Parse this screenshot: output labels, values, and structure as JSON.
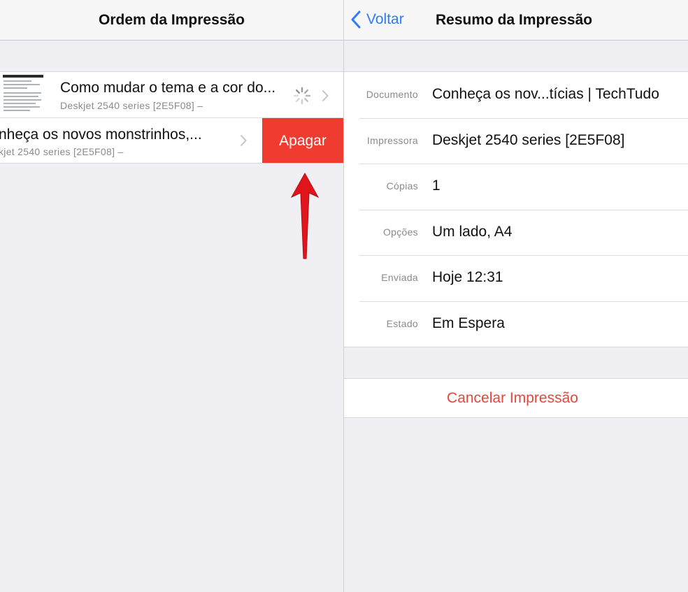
{
  "left": {
    "title": "Ordem da Impressão",
    "jobs": [
      {
        "title": "Como mudar o tema e a cor do...",
        "subtitle": "Deskjet 2540 series [2E5F08] –"
      },
      {
        "title": "nheça os novos monstrinhos,...",
        "subtitle": "kjet 2540 series [2E5F08] –",
        "delete_label": "Apagar"
      }
    ]
  },
  "right": {
    "back_label": "Voltar",
    "title": "Resumo da Impressão",
    "details": [
      {
        "label": "Documento",
        "value": "Conheça os nov...tícias | TechTudo"
      },
      {
        "label": "Impressora",
        "value": "Deskjet 2540 series [2E5F08]"
      },
      {
        "label": "Cópias",
        "value": "1"
      },
      {
        "label": "Opções",
        "value": "Um lado, A4"
      },
      {
        "label": "Enviada",
        "value": "Hoje 12:31"
      },
      {
        "label": "Estado",
        "value": "Em Espera"
      }
    ],
    "cancel_label": "Cancelar Impressão"
  },
  "colors": {
    "accent": "#2f7cf6",
    "destructive": "#f03b30",
    "cancel_text": "#e8453c",
    "background": "#efeff4",
    "annotation_arrow": "#e0141b"
  },
  "icons": {
    "back": "chevron-left-icon",
    "disclosure": "chevron-right-icon",
    "activity": "spinner-icon",
    "annotation": "red-arrow-up-icon"
  }
}
